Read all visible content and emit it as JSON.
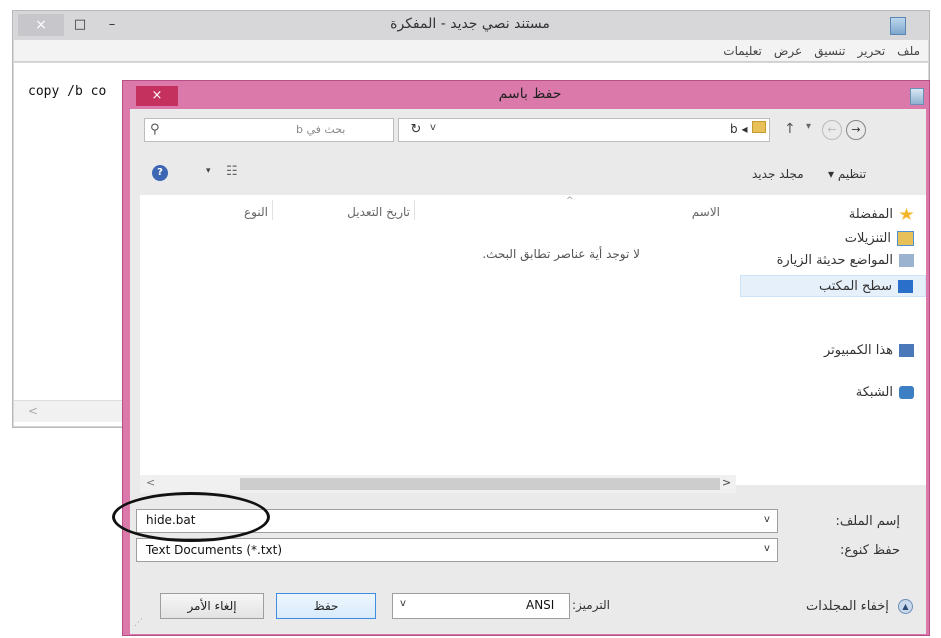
{
  "notepad": {
    "title": "مستند نصي جديد - المفكرة",
    "close_glyph": "×",
    "maximize_glyph": "□",
    "minimize_glyph": "–",
    "menus": [
      "ملف",
      "تحرير",
      "تنسيق",
      "عرض",
      "تعليمات"
    ],
    "content": "copy /b co",
    "hscroll_glyph": "<"
  },
  "dialog": {
    "title": "حفظ باسم",
    "close_glyph": "×",
    "address": {
      "path": "b",
      "path_separator": "◂",
      "search_placeholder": "بحث في b",
      "refresh_glyph": "↻",
      "dropdown_glyph": "v",
      "up_glyph": "↑",
      "recent_glyph": "▾",
      "forward_glyph": "←",
      "back_glyph": "→"
    },
    "toolbar": {
      "organize": "تنظيم ▾",
      "new_folder": "مجلد جديد",
      "view_drop": "▾",
      "view_glyph": "☷",
      "help_glyph": "?"
    },
    "nav": [
      {
        "label": "المفضلة",
        "icon": "star-icon",
        "color": "#f3b52b"
      },
      {
        "label": "التنزيلات",
        "icon": "downloads-folder-icon",
        "color": "#4f8fd3"
      },
      {
        "label": "المواضع حديثة الزيارة",
        "icon": "recent-places-icon",
        "color": "#9bb3cf"
      },
      {
        "label": "سطح المكتب",
        "icon": "desktop-icon",
        "color": "#2a6fc9"
      },
      {
        "label": "هذا الكمبيوتر",
        "icon": "computer-icon",
        "color": "#4a78b8"
      },
      {
        "label": "الشبكة",
        "icon": "network-icon",
        "color": "#3c7fc2"
      }
    ],
    "columns": {
      "name": "الاسم",
      "date_modified": "تاريخ التعديل",
      "type": "النوع",
      "sort_glyph": "^"
    },
    "empty_message": "لا توجد أية عناصر تطابق البحث.",
    "scroll": {
      "left_glyph": "<",
      "right_glyph": ">"
    },
    "filename_label": "إسم الملف:",
    "filename_value": "hide.bat",
    "savetype_label": "حفظ كنوع:",
    "savetype_value": "Text Documents (*.txt)",
    "select_glyph": "v",
    "hide_folders": "إخفاء المجلدات",
    "hide_folders_glyph": "▲",
    "encoding_label": "الترميز:",
    "encoding_value": "ANSI",
    "save_button": "حفظ",
    "cancel_button": "إلغاء الأمر",
    "grip_glyph": "⋰"
  },
  "colors": {
    "dialog_frame": "#dc79ab",
    "dialog_close": "#c4315f",
    "selection": "#e5f0fb"
  }
}
